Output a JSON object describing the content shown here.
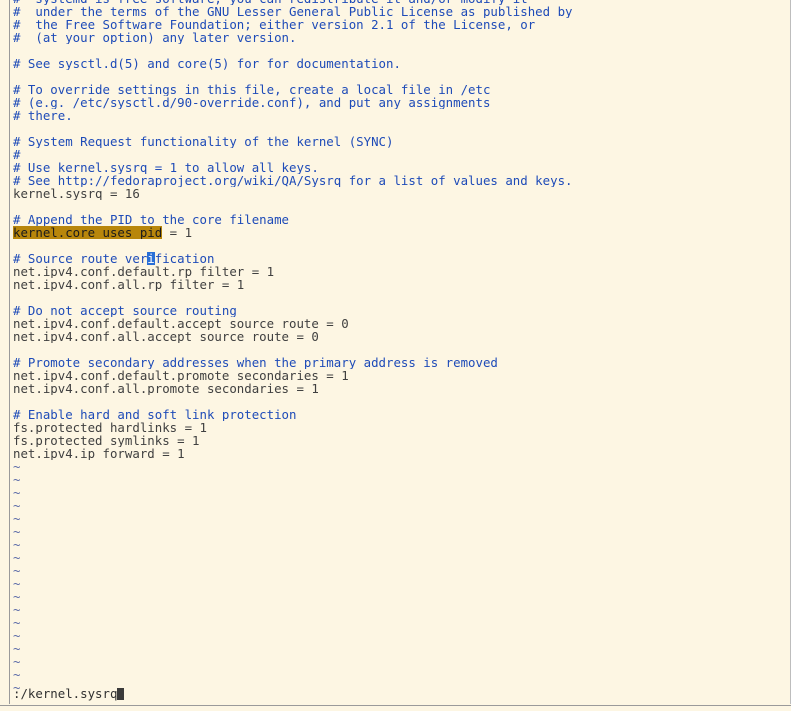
{
  "lines": [
    {
      "type": "comment",
      "text": "#  systemd is free software; you can redistribute it and/or modify it"
    },
    {
      "type": "comment",
      "text": "#  under the terms of the GNU Lesser General Public License as published by"
    },
    {
      "type": "comment",
      "text": "#  the Free Software Foundation; either version 2.1 of the License, or"
    },
    {
      "type": "comment",
      "text": "#  (at your option) any later version."
    },
    {
      "type": "blank",
      "text": ""
    },
    {
      "type": "comment",
      "text": "# See sysctl.d(5) and core(5) for for documentation."
    },
    {
      "type": "blank",
      "text": ""
    },
    {
      "type": "comment",
      "text": "# To override settings in this file, create a local file in /etc"
    },
    {
      "type": "comment",
      "text": "# (e.g. /etc/sysctl.d/90-override.conf), and put any assignments"
    },
    {
      "type": "comment",
      "text": "# there."
    },
    {
      "type": "blank",
      "text": ""
    },
    {
      "type": "comment",
      "text": "# System Request functionality of the kernel (SYNC)"
    },
    {
      "type": "comment",
      "text": "#"
    },
    {
      "type": "comment",
      "text": "# Use kernel.sysrq = 1 to allow all keys."
    },
    {
      "type": "comment",
      "text": "# See http://fedoraproject.org/wiki/QA/Sysrq for a list of values and keys."
    },
    {
      "type": "code",
      "text": "kernel.sysrq = 16"
    },
    {
      "type": "blank",
      "text": ""
    },
    {
      "type": "comment",
      "text": "# Append the PID to the core filename"
    },
    {
      "type": "code-highlight",
      "highlight": "kernel.core_uses_pid",
      "rest": " = 1"
    },
    {
      "type": "blank",
      "text": ""
    },
    {
      "type": "comment-cursor",
      "before": "# Source route ver",
      "cursor": "i",
      "after": "fication"
    },
    {
      "type": "code",
      "text": "net.ipv4.conf.default.rp_filter = 1"
    },
    {
      "type": "code",
      "text": "net.ipv4.conf.all.rp_filter = 1"
    },
    {
      "type": "blank",
      "text": ""
    },
    {
      "type": "comment",
      "text": "# Do not accept source routing"
    },
    {
      "type": "code",
      "text": "net.ipv4.conf.default.accept_source_route = 0"
    },
    {
      "type": "code",
      "text": "net.ipv4.conf.all.accept_source_route = 0"
    },
    {
      "type": "blank",
      "text": ""
    },
    {
      "type": "comment",
      "text": "# Promote secondary addresses when the primary address is removed"
    },
    {
      "type": "code",
      "text": "net.ipv4.conf.default.promote_secondaries = 1"
    },
    {
      "type": "code",
      "text": "net.ipv4.conf.all.promote_secondaries = 1"
    },
    {
      "type": "blank",
      "text": ""
    },
    {
      "type": "comment",
      "text": "# Enable hard and soft link protection"
    },
    {
      "type": "code",
      "text": "fs.protected_hardlinks = 1"
    },
    {
      "type": "code",
      "text": "fs.protected_symlinks = 1"
    },
    {
      "type": "code",
      "text": "net.ipv4.ip_forward = 1"
    },
    {
      "type": "tilde",
      "text": "~"
    },
    {
      "type": "tilde",
      "text": "~"
    },
    {
      "type": "tilde",
      "text": "~"
    },
    {
      "type": "tilde",
      "text": "~"
    },
    {
      "type": "tilde",
      "text": "~"
    },
    {
      "type": "tilde",
      "text": "~"
    },
    {
      "type": "tilde",
      "text": "~"
    },
    {
      "type": "tilde",
      "text": "~"
    },
    {
      "type": "tilde",
      "text": "~"
    },
    {
      "type": "tilde",
      "text": "~"
    },
    {
      "type": "tilde",
      "text": "~"
    },
    {
      "type": "tilde",
      "text": "~"
    },
    {
      "type": "tilde",
      "text": "~"
    },
    {
      "type": "tilde",
      "text": "~"
    },
    {
      "type": "tilde",
      "text": "~"
    },
    {
      "type": "tilde",
      "text": "~"
    },
    {
      "type": "tilde",
      "text": "~"
    },
    {
      "type": "tilde",
      "text": "~"
    }
  ],
  "command_line": {
    "text": ":/kernel.sysrq"
  }
}
